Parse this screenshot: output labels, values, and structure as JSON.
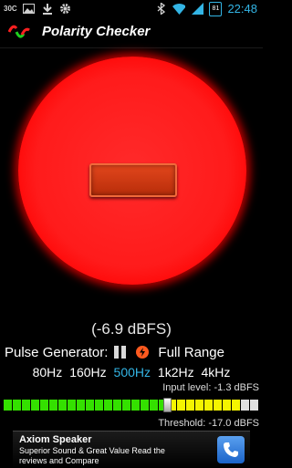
{
  "status_bar": {
    "temperature": "30C",
    "icons": [
      "image-icon",
      "download-icon",
      "settings-icon",
      "bluetooth-icon",
      "wifi-icon",
      "signal-icon",
      "battery-icon"
    ],
    "battery": "81",
    "time": "22:48"
  },
  "app": {
    "title": "Polarity Checker",
    "icon": "polarity-icon"
  },
  "indicator": {
    "polarity": "minus",
    "color": "#ff1b1b"
  },
  "level_text": "(-6.9 dBFS)",
  "pulse": {
    "label": "Pulse Generator:",
    "state_icon": "pause-icon",
    "range_icon": "range-icon",
    "range_label": "Full Range"
  },
  "frequencies": [
    {
      "label": "80Hz",
      "active": false
    },
    {
      "label": "160Hz",
      "active": false
    },
    {
      "label": "500Hz",
      "active": true
    },
    {
      "label": "1k2Hz",
      "active": false
    },
    {
      "label": "4kHz",
      "active": false
    }
  ],
  "input_level": "Input level: -1.3 dBFS",
  "threshold": {
    "label": "Threshold: -17.0 dBFS",
    "value_fraction": 0.64
  },
  "meter_colors": {
    "green": "#34e000",
    "yellow": "#f4f400",
    "off": "#e0e0e0"
  },
  "ad": {
    "title": "Axiom Speaker",
    "text": "Superior Sound & Great Value Read the reviews and Compare",
    "icon": "phone-icon"
  }
}
